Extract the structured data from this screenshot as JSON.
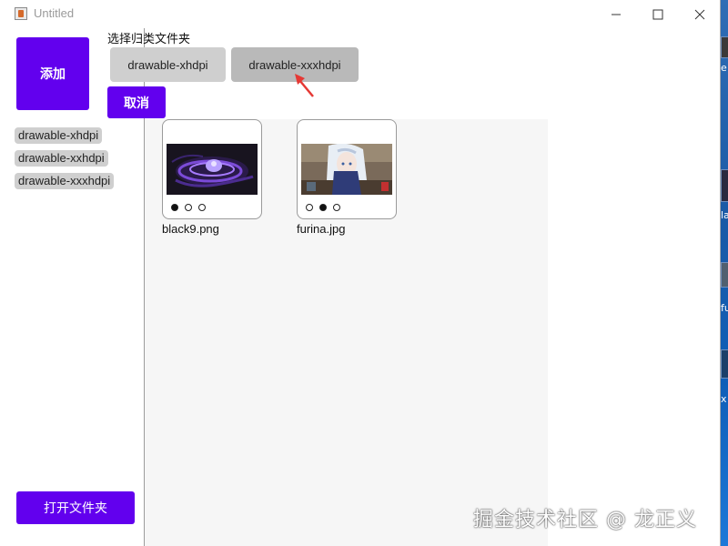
{
  "window": {
    "title": "Untitled"
  },
  "sidebar": {
    "add_label": "添加",
    "folders": [
      "drawable-xhdpi",
      "drawable-xxhdpi",
      "drawable-xxxhdpi"
    ],
    "open_folder_label": "打开文件夹"
  },
  "chooser": {
    "title": "选择归类文件夹",
    "options": [
      "drawable-xhdpi",
      "drawable-xxxhdpi"
    ],
    "cancel_label": "取消"
  },
  "gallery": {
    "files": [
      {
        "name": "black9.png",
        "selected_dot": 1
      },
      {
        "name": "furina.jpg",
        "selected_dot": 2
      }
    ]
  },
  "desktop_fragments": [
    "e",
    "la",
    "fu",
    "x"
  ],
  "watermark": "掘金技术社区 @ 龙正义",
  "colors": {
    "accent": "#6200ee",
    "option_default": "#cfcfcf",
    "option_hover": "#b9b9b9",
    "arrow": "#e53935"
  }
}
